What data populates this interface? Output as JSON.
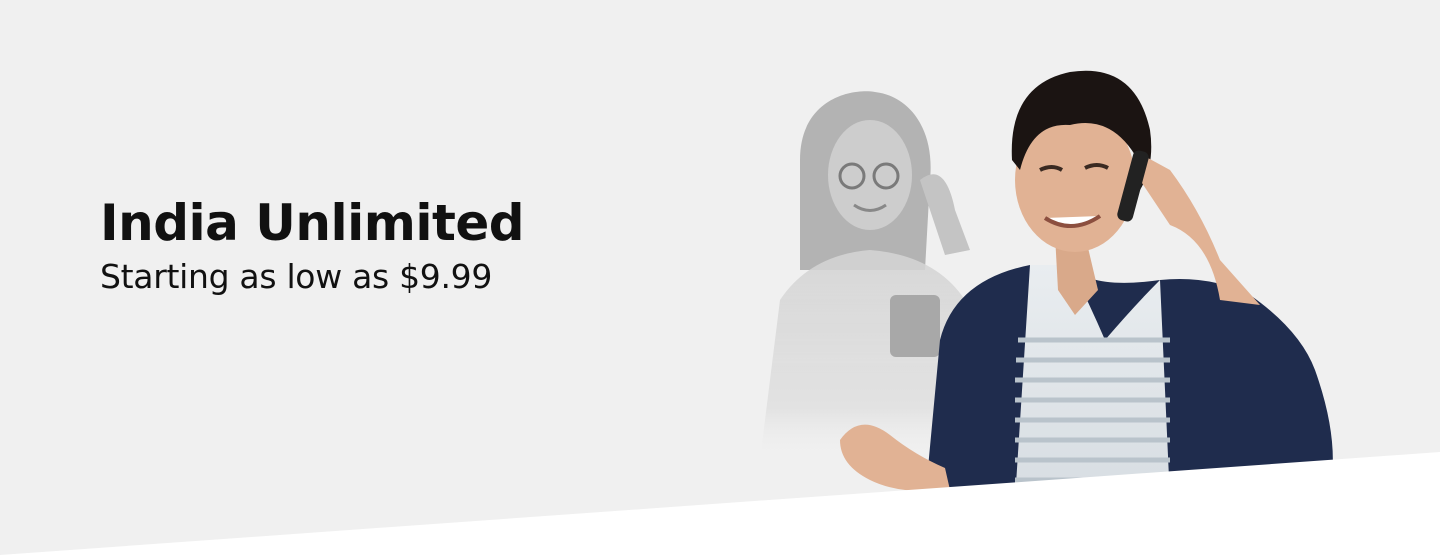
{
  "banner": {
    "title": "India Unlimited",
    "subtitle": "Starting as low as $9.99",
    "background_color": "#f0f0f0",
    "image_description_icon": "promo-photo-people-on-phones"
  }
}
